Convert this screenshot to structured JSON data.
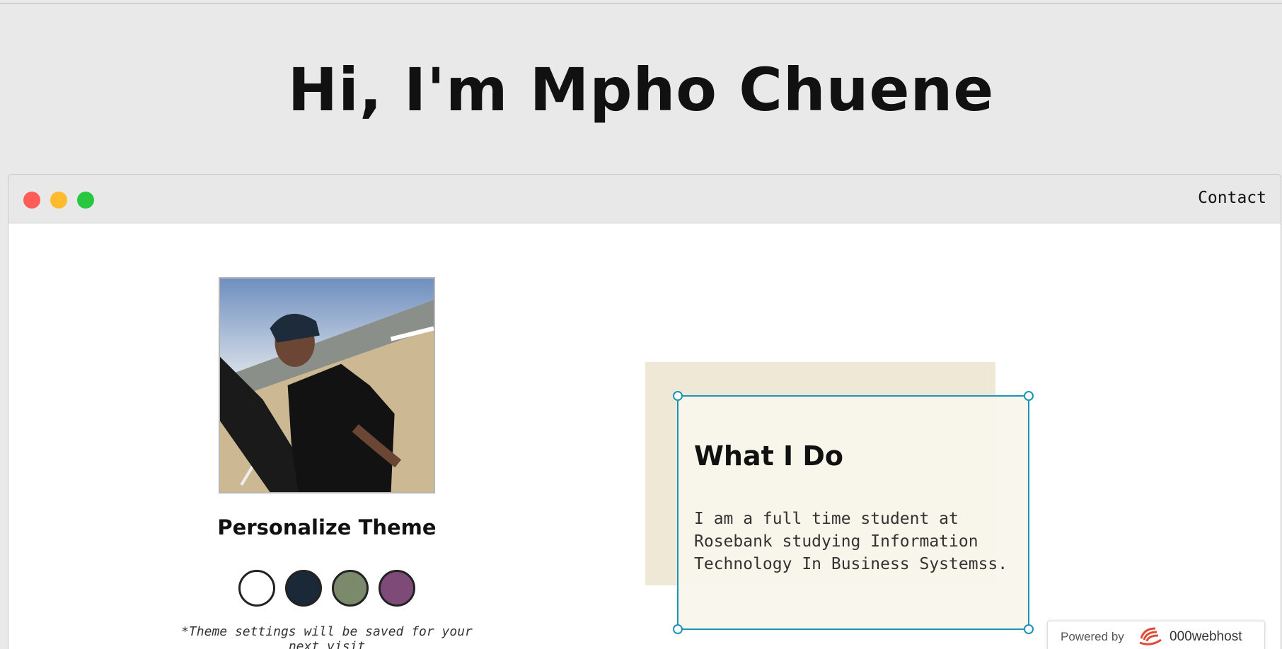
{
  "header": {
    "title": "Hi, I'm Mpho Chuene"
  },
  "window": {
    "traffic_lights": {
      "close": "#fd5d56",
      "minimize": "#febb2d",
      "maximize": "#28c73f"
    },
    "nav": {
      "contact_label": "Contact"
    }
  },
  "profile": {
    "theme_heading": "Personalize Theme",
    "swatches": [
      {
        "name": "white",
        "color": "#ffffff"
      },
      {
        "name": "navy",
        "color": "#1b2838"
      },
      {
        "name": "sage",
        "color": "#7a8a6b"
      },
      {
        "name": "purple",
        "color": "#7e4a78"
      }
    ],
    "theme_note": "*Theme settings will be saved for your next visit"
  },
  "about": {
    "title": "What I Do",
    "text": "I am a full time student at Rosebank studying Information Technology In Business Systemss."
  },
  "badge": {
    "powered_by": "Powered by",
    "host_name": "000webhost"
  }
}
